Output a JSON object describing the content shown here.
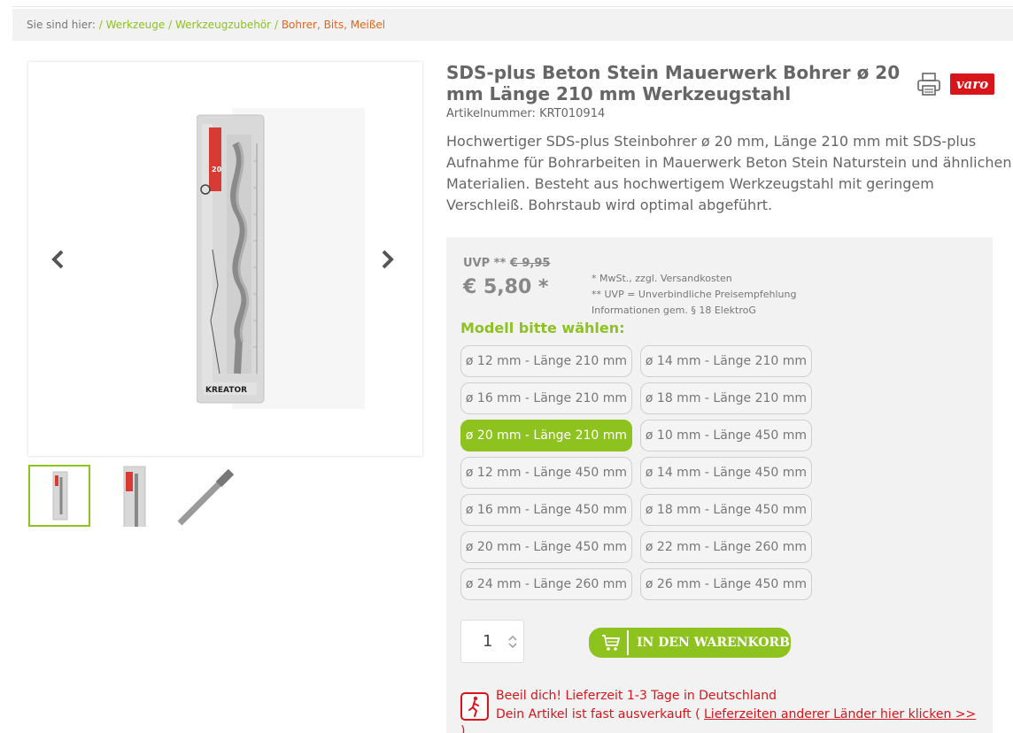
{
  "breadcrumb": {
    "prefix": "Sie sind hier:",
    "sep": "/",
    "items": [
      "Werkzeuge",
      "Werkzeugzubehör"
    ],
    "current": "Bohrer, Bits, Meißel"
  },
  "gallery": {
    "product_brand_text": "KREATOR",
    "thumbnail_count": 3
  },
  "product": {
    "title": "SDS-plus Beton Stein Mauerwerk Bohrer ø 20 mm Länge 210 mm Werkzeugstahl",
    "sku_label": "Artikelnummer:",
    "sku": "KRT010914",
    "brand": "varo",
    "description": "Hochwertiger SDS-plus Steinbohrer ø 20 mm, Länge 210 mm mit SDS-plus Aufnahme für Bohrarbeiten in Mauerwerk Beton Stein Naturstein und ähnlichen Materialien. Besteht aus hochwertigem Werkzeugstahl mit geringem Verschleiß. Bohrstaub wird optimal abgeführt."
  },
  "pricing": {
    "uvp_label": "UVP **",
    "uvp_old": "€ 9,95",
    "price": "€ 5,80 *",
    "notes": [
      "* MwSt., zzgl. Versandkosten",
      "** UVP = Unverbindliche Preisempfehlung",
      "Informationen gem. § 18 ElektroG"
    ]
  },
  "model_label": "Modell bitte wählen:",
  "variants": [
    {
      "label": "ø 12 mm - Länge 210 mm",
      "selected": false
    },
    {
      "label": "ø 14 mm - Länge 210 mm",
      "selected": false
    },
    {
      "label": "ø 16 mm - Länge 210 mm",
      "selected": false
    },
    {
      "label": "ø 18 mm - Länge 210 mm",
      "selected": false
    },
    {
      "label": "ø 20 mm - Länge 210 mm",
      "selected": true
    },
    {
      "label": "ø 10 mm - Länge 450 mm",
      "selected": false
    },
    {
      "label": "ø 12 mm - Länge 450 mm",
      "selected": false
    },
    {
      "label": "ø 14 mm - Länge 450 mm",
      "selected": false
    },
    {
      "label": "ø 16 mm - Länge 450 mm",
      "selected": false
    },
    {
      "label": "ø 18 mm - Länge 450 mm",
      "selected": false
    },
    {
      "label": "ø 20 mm - Länge 450 mm",
      "selected": false
    },
    {
      "label": "ø 22 mm - Länge 260 mm",
      "selected": false
    },
    {
      "label": "ø 24 mm - Länge 260 mm",
      "selected": false
    },
    {
      "label": "ø 26 mm - Länge 450 mm",
      "selected": false
    }
  ],
  "quantity": "1",
  "cart_button": "IN DEN WARENKORB",
  "urgency": {
    "line1": "Beeil dich! Lieferzeit 1-3 Tage in Deutschland",
    "line2_prefix": "Dein Artikel ist fast ausverkauft (",
    "line2_link": "Lieferzeiten anderer Länder hier klicken >>",
    "line2_suffix": ")"
  },
  "colors": {
    "accent_green": "#8dc21f",
    "breadcrumb_current": "#e8641b",
    "urgent_red": "#d7151a",
    "brand_red": "#d7151a"
  },
  "icons": [
    "chevron-left-icon",
    "chevron-right-icon",
    "print-icon",
    "cart-icon",
    "hourglass-runner-icon",
    "spinner-arrows-icon"
  ]
}
